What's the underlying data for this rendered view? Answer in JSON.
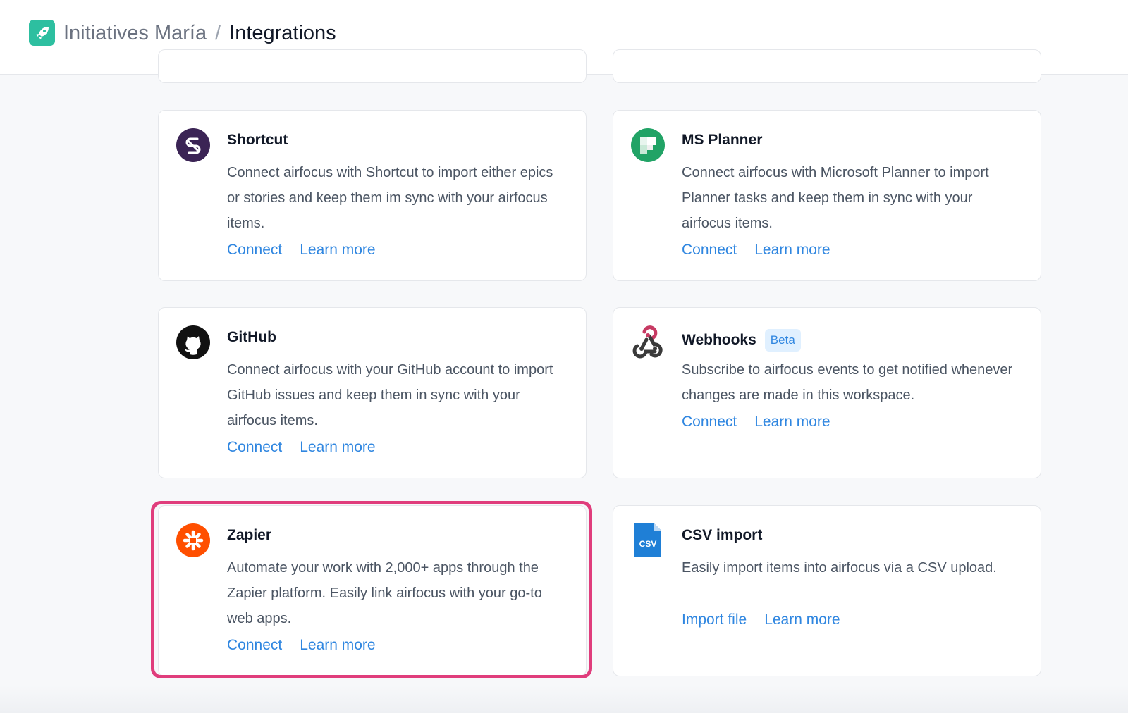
{
  "header": {
    "workspace": "Initiatives María",
    "separator": "/",
    "page_title": "Integrations"
  },
  "cards": [
    {
      "title": "Shortcut",
      "description": "Connect airfocus with Shortcut to import either epics or stories and keep them im sync with your airfocus items.",
      "primary_action": "Connect",
      "secondary_action": "Learn more",
      "icon": "shortcut-icon"
    },
    {
      "title": "MS Planner",
      "description": "Connect airfocus with Microsoft Planner to import Planner tasks and keep them in sync with your airfocus items.",
      "primary_action": "Connect",
      "secondary_action": "Learn more",
      "icon": "ms-planner-icon"
    },
    {
      "title": "GitHub",
      "description": "Connect airfocus with your GitHub account to import GitHub issues and keep them in sync with your airfocus items.",
      "primary_action": "Connect",
      "secondary_action": "Learn more",
      "icon": "github-icon"
    },
    {
      "title": "Webhooks",
      "badge": "Beta",
      "description": "Subscribe to airfocus events to get notified whenever changes are made in this workspace.",
      "primary_action": "Connect",
      "secondary_action": "Learn more",
      "icon": "webhooks-icon"
    },
    {
      "title": "Zapier",
      "description": "Automate your work with 2,000+ apps through the Zapier platform. Easily link airfocus with your go-to web apps.",
      "primary_action": "Connect",
      "secondary_action": "Learn more",
      "icon": "zapier-icon"
    },
    {
      "title": "CSV import",
      "description": "Easily import items into airfocus via a CSV upload.",
      "primary_action": "Import file",
      "secondary_action": "Learn more",
      "icon": "csv-file-icon",
      "icon_text": "CSV"
    }
  ],
  "colors": {
    "link": "#2f86e0",
    "highlight": "#e03d7c",
    "logo": "#2dbfa0"
  }
}
